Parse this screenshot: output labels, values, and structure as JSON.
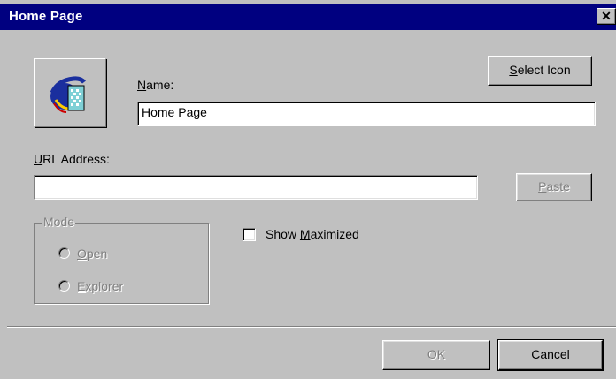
{
  "window": {
    "title": "Home Page",
    "close_glyph": "✕"
  },
  "icon": {
    "name": "internet-explorer-icon"
  },
  "select_icon_button": {
    "label": "Select Icon",
    "mnemonic": "S",
    "rest": "elect Icon"
  },
  "name_field": {
    "label_mnemonic": "N",
    "label_rest": "ame:",
    "value": "Home Page"
  },
  "url_field": {
    "label_mnemonic": "U",
    "label_rest": "RL Address:",
    "value": ""
  },
  "paste_button": {
    "mnemonic": "P",
    "rest": "aste",
    "disabled": true
  },
  "mode_group": {
    "legend": "Mode",
    "options": [
      {
        "mnemonic": "O",
        "rest": "pen",
        "disabled": true
      },
      {
        "mnemonic": "E",
        "rest": "xplorer",
        "disabled": true
      }
    ]
  },
  "show_maximized": {
    "prefix": "Show ",
    "mnemonic": "M",
    "rest": "aximized",
    "checked": false
  },
  "ok_button": {
    "label": "OK",
    "disabled": true
  },
  "cancel_button": {
    "label": "Cancel"
  },
  "colors": {
    "titlebar": "#000080",
    "face": "#c0c0c0",
    "disabled_text": "#808080"
  }
}
